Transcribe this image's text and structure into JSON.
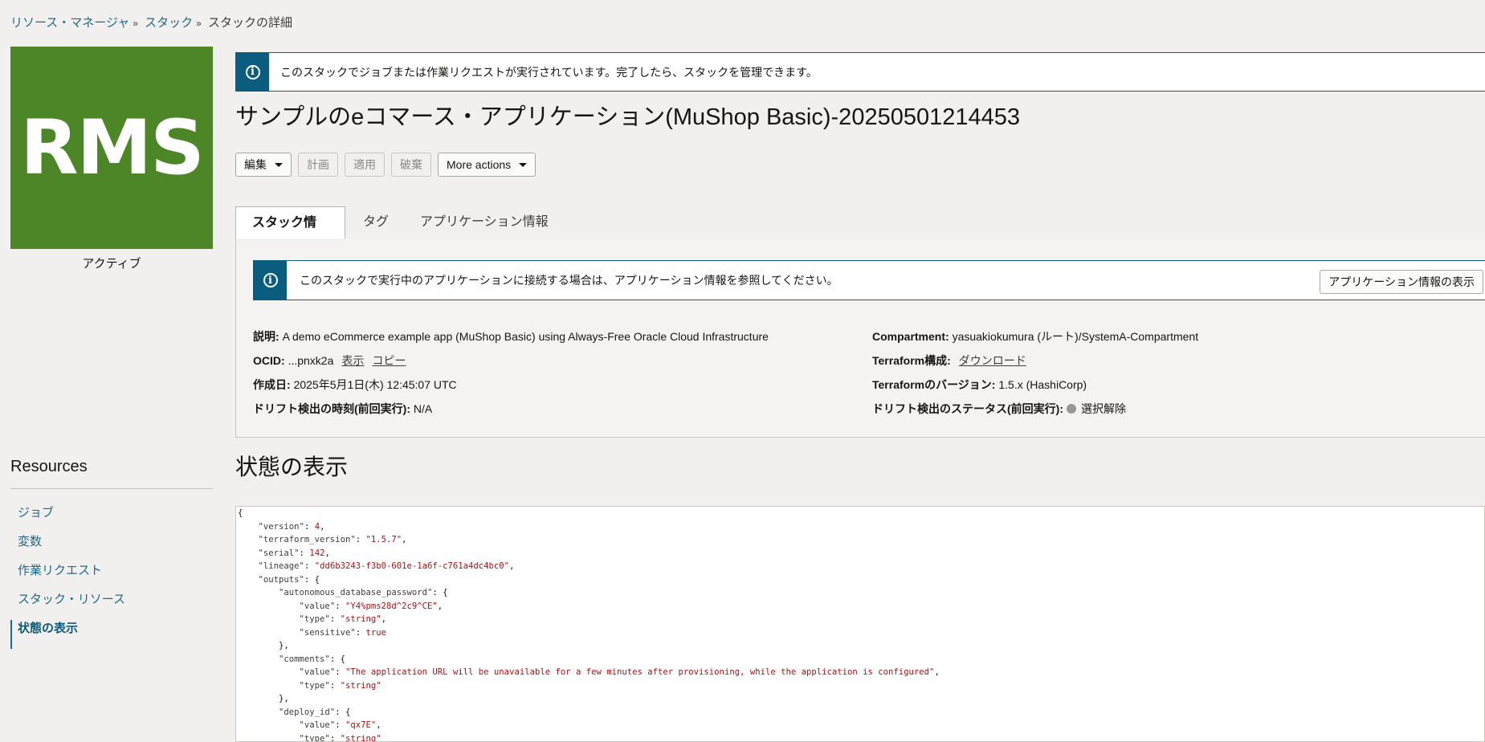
{
  "breadcrumb": {
    "items": [
      "リソース・マネージャ",
      "スタック"
    ],
    "current": "スタックの詳細",
    "separator": "»"
  },
  "logo": {
    "text": "RMS",
    "color": "#4c8627"
  },
  "status": "アクティブ",
  "banner": {
    "icon": "info-icon",
    "text": "このスタックでジョブまたは作業リクエストが実行されています。完了したら、スタックを管理できます。"
  },
  "title": "サンプルのeコマース・アプリケーション(MuShop Basic)-20250501214453",
  "actions": {
    "edit": "編集",
    "plan": "計画",
    "apply": "適用",
    "destroy": "破棄",
    "more": "More actions"
  },
  "tabs": [
    "スタック情報",
    "タグ",
    "アプリケーション情報"
  ],
  "info_banner": {
    "text": "このスタックで実行中のアプリケーションに接続する場合は、アプリケーション情報を参照してください。",
    "button": "アプリケーション情報の表示"
  },
  "details": {
    "description_label": "説明:",
    "description": "A demo eCommerce example app (MuShop Basic) using Always-Free Oracle Cloud Infrastructure",
    "ocid_label": "OCID:",
    "ocid": "...pnxk2a",
    "show": "表示",
    "copy": "コピー",
    "created_label": "作成日:",
    "created": "2025年5月1日(木) 12:45:07 UTC",
    "drift_time_label": "ドリフト検出の時刻(前回実行):",
    "drift_time": "N/A",
    "compartment_label": "Compartment:",
    "compartment": "yasuakiokumura (ルート)/SystemA-Compartment",
    "tf_config_label": "Terraform構成:",
    "tf_config_link": "ダウンロード",
    "tf_version_label": "Terraformのバージョン:",
    "tf_version": "1.5.x (HashiCorp)",
    "drift_status_label": "ドリフト検出のステータス(前回実行):",
    "drift_status": "選択解除"
  },
  "resources": {
    "title": "Resources",
    "items": [
      "ジョブ",
      "変数",
      "作業リクエスト",
      "スタック・リソース",
      "状態の表示"
    ],
    "active_index": 4
  },
  "state": {
    "title": "状態の表示",
    "lines": [
      [
        [
          "p",
          "{"
        ]
      ],
      [
        [
          "p",
          "    "
        ],
        [
          "k",
          "\"version\""
        ],
        [
          "p",
          ": "
        ],
        [
          "n",
          "4"
        ],
        [
          "p",
          ","
        ]
      ],
      [
        [
          "p",
          "    "
        ],
        [
          "k",
          "\"terraform_version\""
        ],
        [
          "p",
          ": "
        ],
        [
          "s",
          "\"1.5.7\""
        ],
        [
          "p",
          ","
        ]
      ],
      [
        [
          "p",
          "    "
        ],
        [
          "k",
          "\"serial\""
        ],
        [
          "p",
          ": "
        ],
        [
          "n",
          "142"
        ],
        [
          "p",
          ","
        ]
      ],
      [
        [
          "p",
          "    "
        ],
        [
          "k",
          "\"lineage\""
        ],
        [
          "p",
          ": "
        ],
        [
          "s",
          "\"dd6b3243-f3b0-601e-1a6f-c761a4dc4bc0\""
        ],
        [
          "p",
          ","
        ]
      ],
      [
        [
          "p",
          "    "
        ],
        [
          "k",
          "\"outputs\""
        ],
        [
          "p",
          ": {"
        ]
      ],
      [
        [
          "p",
          "        "
        ],
        [
          "k",
          "\"autonomous_database_password\""
        ],
        [
          "p",
          ": {"
        ]
      ],
      [
        [
          "p",
          "            "
        ],
        [
          "k",
          "\"value\""
        ],
        [
          "p",
          ": "
        ],
        [
          "s",
          "\"Y4%pms28d^2c9^CE\""
        ],
        [
          "p",
          ","
        ]
      ],
      [
        [
          "p",
          "            "
        ],
        [
          "k",
          "\"type\""
        ],
        [
          "p",
          ": "
        ],
        [
          "s",
          "\"string\""
        ],
        [
          "p",
          ","
        ]
      ],
      [
        [
          "p",
          "            "
        ],
        [
          "k",
          "\"sensitive\""
        ],
        [
          "p",
          ": "
        ],
        [
          "n",
          "true"
        ]
      ],
      [
        [
          "p",
          "        },"
        ]
      ],
      [
        [
          "p",
          "        "
        ],
        [
          "k",
          "\"comments\""
        ],
        [
          "p",
          ": {"
        ]
      ],
      [
        [
          "p",
          "            "
        ],
        [
          "k",
          "\"value\""
        ],
        [
          "p",
          ": "
        ],
        [
          "s",
          "\"The application URL will be unavailable for a few minutes after provisioning, while the application is configured\""
        ],
        [
          "p",
          ","
        ]
      ],
      [
        [
          "p",
          "            "
        ],
        [
          "k",
          "\"type\""
        ],
        [
          "p",
          ": "
        ],
        [
          "s",
          "\"string\""
        ]
      ],
      [
        [
          "p",
          "        },"
        ]
      ],
      [
        [
          "p",
          "        "
        ],
        [
          "k",
          "\"deploy_id\""
        ],
        [
          "p",
          ": {"
        ]
      ],
      [
        [
          "p",
          "            "
        ],
        [
          "k",
          "\"value\""
        ],
        [
          "p",
          ": "
        ],
        [
          "s",
          "\"qx7E\""
        ],
        [
          "p",
          ","
        ]
      ],
      [
        [
          "p",
          "            "
        ],
        [
          "k",
          "\"type\""
        ],
        [
          "p",
          ": "
        ],
        [
          "s",
          "\"string\""
        ]
      ]
    ]
  }
}
